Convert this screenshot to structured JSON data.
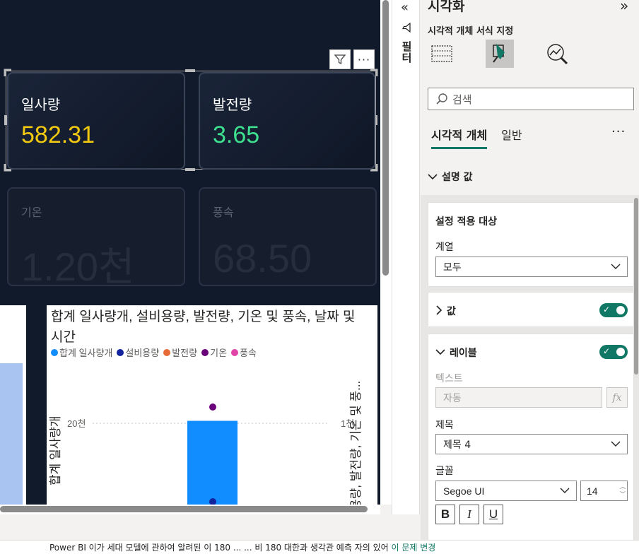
{
  "cards": [
    {
      "caption": "일사량",
      "value": "582.31",
      "color": "#f2c811"
    },
    {
      "caption": "발전량",
      "value": "3.65",
      "color": "#3de08f"
    },
    {
      "caption": "기온",
      "value": "1.20천",
      "color": "#262e3e"
    },
    {
      "caption": "풍속",
      "value": "68.50",
      "color": "#262e3e"
    }
  ],
  "chart": {
    "title": "합계 일사량개, 설비용량, 발전량, 기온 및 풍속, 날짜 및 시간",
    "legend": [
      {
        "name": "합계 일사량개",
        "color": "#118dff"
      },
      {
        "name": "설비용량",
        "color": "#12239e"
      },
      {
        "name": "발전량",
        "color": "#e66c37"
      },
      {
        "name": "기온",
        "color": "#6b007b"
      },
      {
        "name": "풍속",
        "color": "#e044a7"
      }
    ],
    "y_left_label": "합계 일사량개",
    "y_right_label": "용량, 발전량, 기온 및 풍...",
    "y_left_tick": "20천",
    "y_right_tick": "1천"
  },
  "chart_data": {
    "type": "bar",
    "title": "합계 일사량개, 설비용량, 발전량, 기온 및 풍속, 날짜 및 시간",
    "ylabel": "합계 일사량개",
    "y2label": "용량, 발전량, 기온 및 풍...",
    "yticks": [
      "20천"
    ],
    "y2ticks": [
      "1천"
    ],
    "series": [
      {
        "name": "합계 일사량개",
        "type": "bar",
        "values": [
          20600
        ]
      },
      {
        "name": "기온",
        "type": "scatter",
        "axis": "right",
        "values": [
          1200
        ]
      },
      {
        "name": "설비용량",
        "type": "scatter",
        "axis": "right",
        "values": [
          35
        ]
      }
    ],
    "grid": true,
    "legend_position": "top-left"
  },
  "filter_pane": {
    "label": "필터"
  },
  "viz_pane": {
    "title": "시각화",
    "subtitle": "시각적 개체 서식 지정",
    "search_placeholder": "검색",
    "tabs": [
      "시각적 개체",
      "일반"
    ],
    "more": "···",
    "section_title": "설명 값",
    "apply_title": "설정 적용 대상",
    "series_label": "계열",
    "series_value": "모두",
    "values_label": "값",
    "labels_label": "레이블",
    "text_label": "텍스트",
    "text_value": "자동",
    "fx": "fx",
    "heading_label": "제목",
    "heading_value": "제목 4",
    "font_label": "글꼴",
    "font_value": "Segoe UI",
    "font_size": "14",
    "bold": "B",
    "italic": "I",
    "underline": "U",
    "accent": "#117865"
  },
  "status": {
    "text": "Power BI 이가 세대 모델에 관하여 알려된 이 180 ... ... 비 180 대한과 생각관 예측 자의 있어 ",
    "link": "이 문제 변경"
  }
}
